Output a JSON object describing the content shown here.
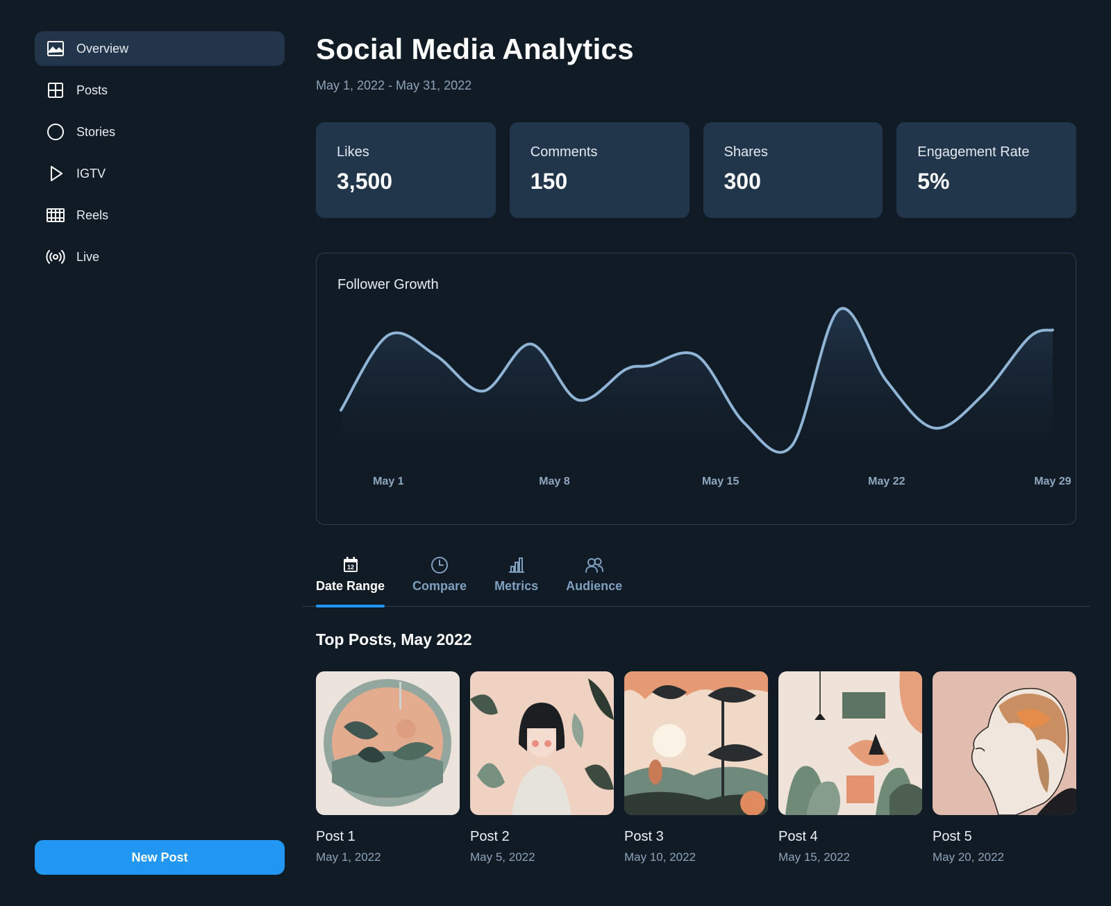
{
  "sidebar": {
    "items": [
      {
        "label": "Overview",
        "icon": "image-icon",
        "active": true
      },
      {
        "label": "Posts",
        "icon": "grid-icon"
      },
      {
        "label": "Stories",
        "icon": "circle-icon"
      },
      {
        "label": "IGTV",
        "icon": "play-icon"
      },
      {
        "label": "Reels",
        "icon": "film-icon"
      },
      {
        "label": "Live",
        "icon": "broadcast-icon"
      }
    ],
    "new_post_label": "New Post"
  },
  "header": {
    "title": "Social Media Analytics",
    "date_range": "May 1, 2022 - May 31, 2022"
  },
  "stats": [
    {
      "label": "Likes",
      "value": "3,500"
    },
    {
      "label": "Comments",
      "value": "150"
    },
    {
      "label": "Shares",
      "value": "300"
    },
    {
      "label": "Engagement Rate",
      "value": "5%"
    }
  ],
  "chart_data": {
    "type": "area",
    "title": "Follower Growth",
    "xlabel": "",
    "ylabel": "",
    "x": [
      1,
      3,
      5,
      7,
      9,
      11,
      13,
      14,
      16,
      18,
      20,
      22,
      24,
      26,
      28,
      30,
      31
    ],
    "y": [
      15,
      74,
      58,
      30,
      67,
      23,
      47,
      50,
      58,
      5,
      -13,
      94,
      38,
      1,
      26,
      72,
      78
    ],
    "xticks": [
      {
        "x": 3,
        "label": "May 1"
      },
      {
        "x": 10,
        "label": "May 8"
      },
      {
        "x": 17,
        "label": "May 15"
      },
      {
        "x": 24,
        "label": "May 22"
      },
      {
        "x": 31,
        "label": "May 29"
      }
    ],
    "xlim": [
      1,
      31
    ],
    "ylim": [
      -20,
      100
    ],
    "grid": false,
    "color": "#8fb4d6"
  },
  "tabs": [
    {
      "label": "Date Range",
      "icon": "calendar-icon",
      "calendar_day": "12",
      "active": true
    },
    {
      "label": "Compare",
      "icon": "clock-icon"
    },
    {
      "label": "Metrics",
      "icon": "bar-chart-icon"
    },
    {
      "label": "Audience",
      "icon": "users-icon"
    }
  ],
  "top_posts": {
    "title": "Top Posts, May 2022",
    "posts": [
      {
        "title": "Post 1",
        "date": "May 1, 2022"
      },
      {
        "title": "Post 2",
        "date": "May 5, 2022"
      },
      {
        "title": "Post 3",
        "date": "May 10, 2022"
      },
      {
        "title": "Post 4",
        "date": "May 15, 2022"
      },
      {
        "title": "Post 5",
        "date": "May 20, 2022"
      }
    ]
  },
  "colors": {
    "background": "#111b26",
    "card": "#22364b",
    "accent": "#2196f3",
    "muted_text": "#8fa3b8"
  }
}
